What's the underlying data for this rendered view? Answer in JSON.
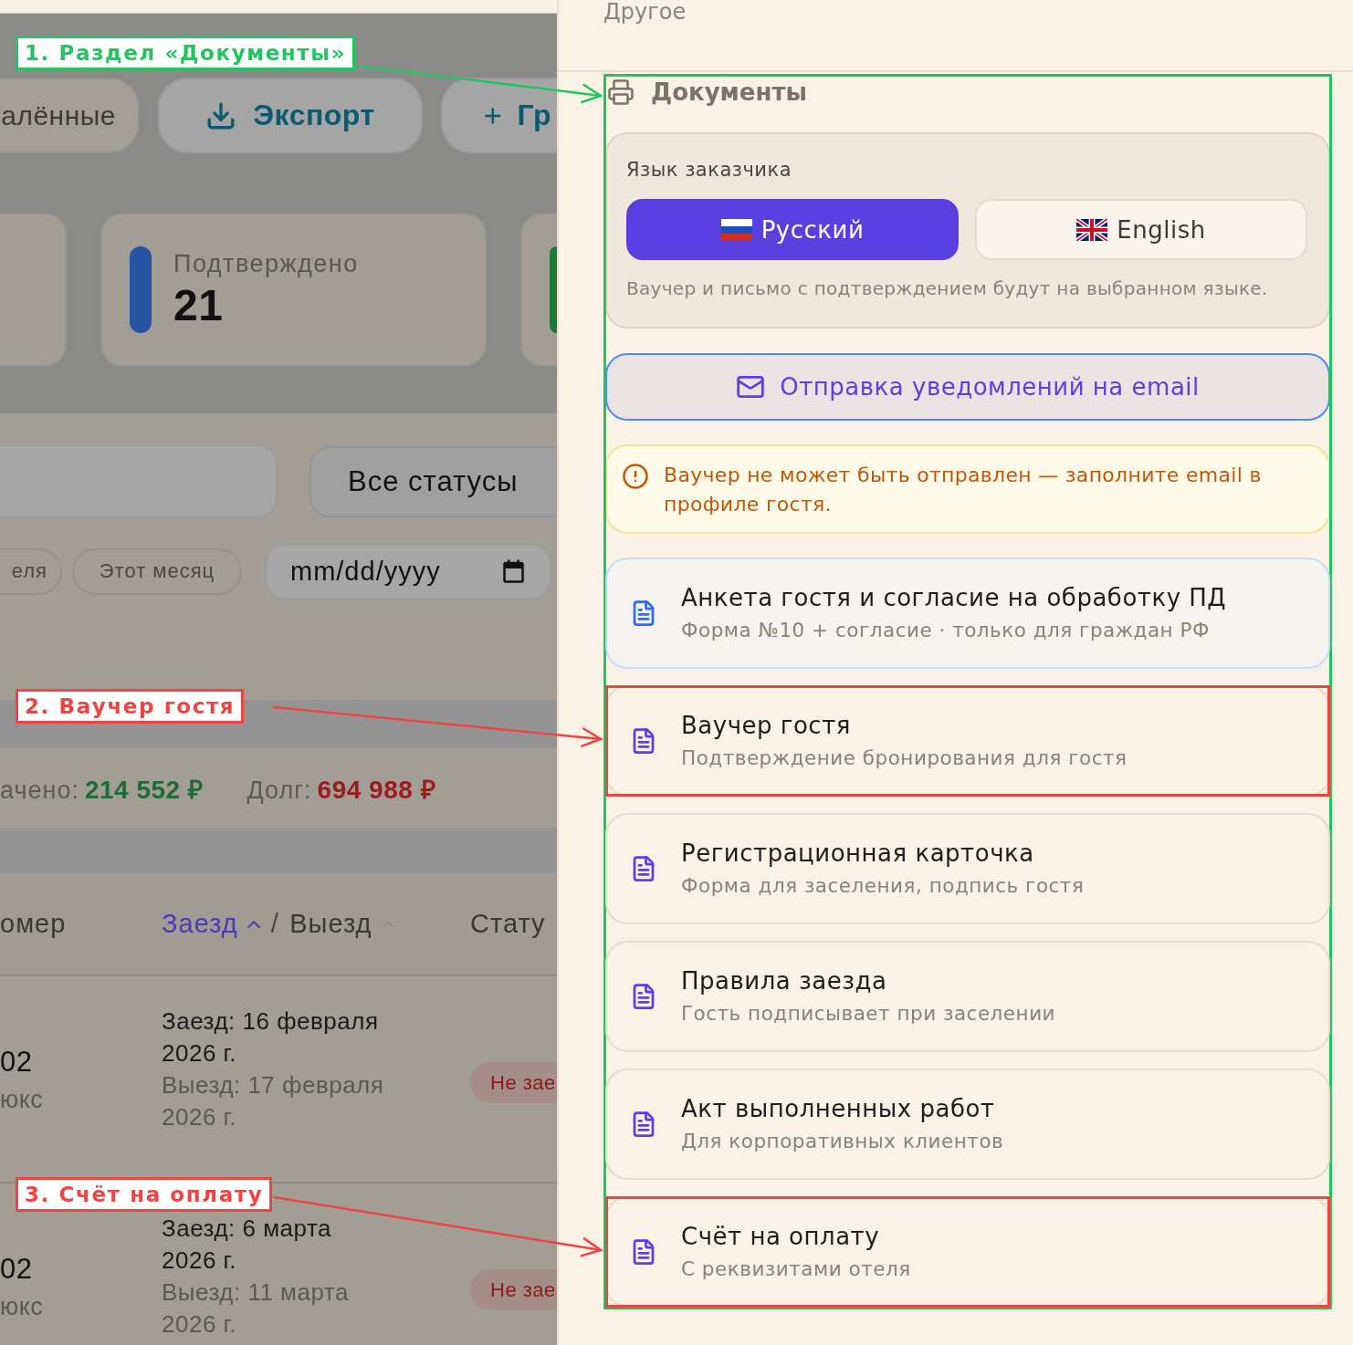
{
  "callouts": [
    {
      "label": "1. Раздел «Документы»",
      "color": "#22c55e"
    },
    {
      "label": "2. Ваучер гостя",
      "color": "#ef4444"
    },
    {
      "label": "3. Счёт на оплату",
      "color": "#ef4444"
    }
  ],
  "background_page": {
    "toolbar": [
      {
        "label": "алённые",
        "kind": "filter"
      },
      {
        "label": "Экспорт",
        "kind": "export"
      },
      {
        "label": "Гр",
        "kind": "add"
      }
    ],
    "stat_cards": [
      {
        "label": "Подтверждено",
        "value": "21",
        "color": "#2753a3"
      },
      {
        "color": "#1c7a37"
      }
    ],
    "filters": {
      "status_select": "Все статусы",
      "chips": [
        {
          "label": "еля",
          "selected": false
        },
        {
          "label": "Этот месяц",
          "selected": false
        }
      ],
      "date": {
        "placeholder": "mm/dd/yyyy"
      }
    },
    "totals": [
      {
        "label": "ачено:",
        "value": "214 552 ₽",
        "kind": "paid"
      },
      {
        "label": "Долг:",
        "value": "694 988 ₽",
        "kind": "debt"
      }
    ],
    "table": {
      "columns": [
        {
          "label": "омер"
        },
        {
          "sort_keys": [
            {
              "label": "Заезд",
              "selected": true
            },
            {
              "label": "Выезд",
              "selected": false
            }
          ],
          "separator": "/"
        },
        {
          "label": "Стату"
        }
      ],
      "rows": [
        {
          "number": "02",
          "room": "юкс",
          "check_in": "Заезд: 16 февраля 2026 г.",
          "check_out": "Выезд: 17 февраля 2026 г.",
          "status": "Не зае"
        },
        {
          "number": "02",
          "room": "юкс",
          "check_in": "Заезд: 6 марта 2026 г.",
          "check_out": "Выезд: 11 марта 2026 г.",
          "status": "Не зае"
        }
      ]
    }
  },
  "drawer": {
    "previous_section": "Другое",
    "documents": {
      "title": "Документы",
      "framed": true,
      "language": {
        "label": "Язык заказчика",
        "options": [
          {
            "label": "Русский",
            "kind": "ru",
            "selected": true
          },
          {
            "label": "English",
            "kind": "gb",
            "selected": false
          }
        ],
        "hint": "Ваучер и письмо с подтверждением будут на выбранном языке."
      },
      "email_button": "Отправка уведомлений на email",
      "warning": "Ваучер не может быть отправлен — заполните email в профиле гостя.",
      "items": [
        {
          "title": "Анкета гостя и согласие на обработку ПД",
          "subtitle": "Форма №10 + согласие · только для граждан РФ",
          "selected": true,
          "framed": false
        },
        {
          "title": "Ваучер гостя",
          "subtitle": "Подтверждение бронирования для гостя",
          "selected": false,
          "framed": true
        },
        {
          "title": "Регистрационная карточка",
          "subtitle": "Форма для заселения, подпись гостя",
          "selected": false,
          "framed": false
        },
        {
          "title": "Правила заезда",
          "subtitle": "Гость подписывает при заселении",
          "selected": false,
          "framed": false
        },
        {
          "title": "Акт выполненных работ",
          "subtitle": "Для корпоративных клиентов",
          "selected": false,
          "framed": false
        },
        {
          "title": "Счёт на оплату",
          "subtitle": "С реквизитами отеля",
          "selected": false,
          "framed": true
        }
      ]
    }
  }
}
